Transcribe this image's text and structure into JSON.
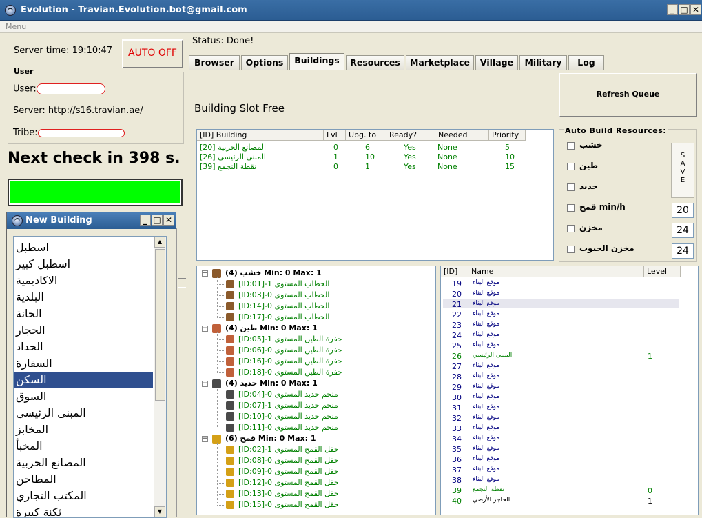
{
  "window": {
    "title": "Evolution - Travian.Evolution.bot@gmail.com",
    "min": "_",
    "max": "□",
    "close": "✕"
  },
  "menu": {
    "label": "Menu"
  },
  "left": {
    "server_time_label": "Server time:",
    "server_time": "19:10:47",
    "auto_button": "AUTO OFF",
    "user_group": "User",
    "user_label": "User:",
    "server_label": "Server: http://s16.travian.ae/",
    "tribe_label": "Tribe:",
    "next_check": "Next check in 398 s."
  },
  "status": "Status: Done!",
  "tabs": [
    "Browser",
    "Options",
    "Buildings",
    "Resources",
    "Marketplace",
    "Village",
    "Military",
    "Log"
  ],
  "refresh_button": "Refresh Queue",
  "slot_label": "Building Slot Free",
  "queue": {
    "headers": [
      "[ID] Building",
      "Lvl",
      "Upg. to",
      "Ready?",
      "Needed",
      "Priority"
    ],
    "rows": [
      [
        "[20] المصانع الحربية",
        "0",
        "6",
        "Yes",
        "None",
        "5"
      ],
      [
        "[26] المبنى الرئيسي",
        "1",
        "10",
        "Yes",
        "None",
        "10"
      ],
      [
        "[39] نقطة التجمع",
        "0",
        "1",
        "Yes",
        "None",
        "15"
      ]
    ]
  },
  "auto_build": {
    "title": "Auto Build Resources:",
    "items": [
      "خشب",
      "طين",
      "حديد",
      "قمح min/h",
      "مخزن",
      "مخزن الحبوب"
    ],
    "values": [
      "20",
      "24",
      "24"
    ],
    "save": [
      "S",
      "A",
      "V",
      "E"
    ]
  },
  "tree": [
    {
      "head": "خشب (4) Min: 0 Max: 1",
      "color": "#8b5a2b",
      "children": [
        "[ID:01]-الحطاب المستوى 1",
        "[ID:03]-الحطاب المستوى 0",
        "[ID:14]-الحطاب المستوى 0",
        "[ID:17]-الحطاب المستوى 0"
      ]
    },
    {
      "head": "طين (4) Min: 0 Max: 1",
      "color": "#c0603a",
      "children": [
        "[ID:05]-حفرة الطين المستوى 1",
        "[ID:06]-حفرة الطين المستوى 0",
        "[ID:16]-حفرة الطين المستوى 0",
        "[ID:18]-حفرة الطين المستوى 0"
      ]
    },
    {
      "head": "حديد (4) Min: 0 Max: 1",
      "color": "#4a4a4a",
      "children": [
        "[ID:04]-منجم حديد المستوى 0",
        "[ID:07]-منجم حديد المستوى 1",
        "[ID:10]-منجم حديد المستوى 0",
        "[ID:11]-منجم حديد المستوى 0"
      ]
    },
    {
      "head": "قمح (6) Min: 0 Max: 1",
      "color": "#d4a017",
      "children": [
        "[ID:02]-حقل القمح المستوى 1",
        "[ID:08]-حقل القمح المستوى 0",
        "[ID:09]-حقل القمح المستوى 0",
        "[ID:12]-حقل القمح المستوى 0",
        "[ID:13]-حقل القمح المستوى 0",
        "[ID:15]-حقل القمح المستوى 0"
      ]
    }
  ],
  "slots": {
    "headers": [
      "[ID]",
      "Name",
      "Level"
    ],
    "rows": [
      [
        "19",
        "موقع البناء",
        ""
      ],
      [
        "20",
        "موقع البناء",
        ""
      ],
      [
        "21",
        "موقع البناء",
        ""
      ],
      [
        "22",
        "موقع البناء",
        ""
      ],
      [
        "23",
        "موقع البناء",
        ""
      ],
      [
        "24",
        "موقع البناء",
        ""
      ],
      [
        "25",
        "موقع البناء",
        ""
      ],
      [
        "26",
        "المبنى الرئيسي",
        "1"
      ],
      [
        "27",
        "موقع البناء",
        ""
      ],
      [
        "28",
        "موقع البناء",
        ""
      ],
      [
        "29",
        "موقع البناء",
        ""
      ],
      [
        "30",
        "موقع البناء",
        ""
      ],
      [
        "31",
        "موقع البناء",
        ""
      ],
      [
        "32",
        "موقع البناء",
        ""
      ],
      [
        "33",
        "موقع البناء",
        ""
      ],
      [
        "34",
        "موقع البناء",
        ""
      ],
      [
        "35",
        "موقع البناء",
        ""
      ],
      [
        "36",
        "موقع البناء",
        ""
      ],
      [
        "37",
        "موقع البناء",
        ""
      ],
      [
        "38",
        "موقع البناء",
        ""
      ],
      [
        "39",
        "نقطة التجمع",
        "0"
      ],
      [
        "40",
        "الحاجز الأرضي",
        "1"
      ]
    ]
  },
  "new_building": {
    "title": "New Building",
    "items": [
      "اسطبل",
      "اسطبل كبير",
      "الاكاديمية",
      "البلدية",
      "الحانة",
      "الحجار",
      "الحداد",
      "السفارة",
      "السكن",
      "السوق",
      "المبنى الرئيسي",
      "المخابز",
      "المخبأ",
      "المصانع الحربية",
      "المطاحن",
      "المكتب التجاري",
      "ثكنة كبيرة"
    ],
    "selected": 8
  }
}
